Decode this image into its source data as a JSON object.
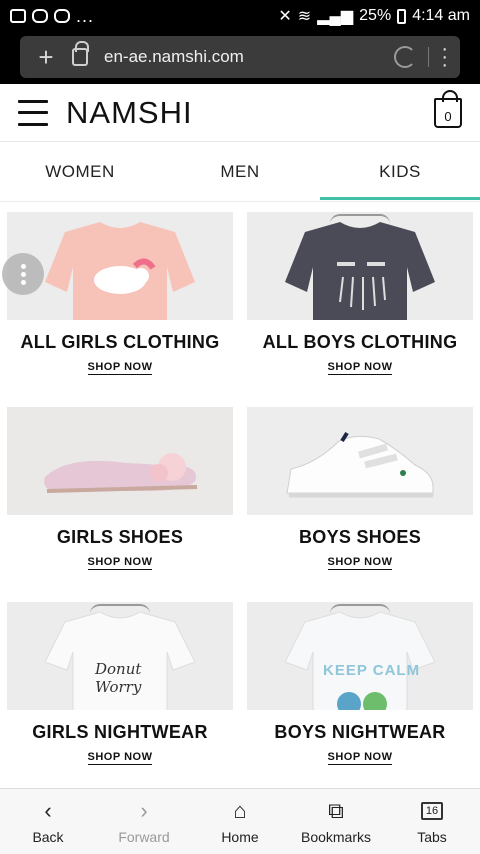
{
  "status_bar": {
    "battery": "25%",
    "time": "4:14 am",
    "more": "..."
  },
  "browser": {
    "url": "en-ae.namshi.com"
  },
  "site": {
    "logo": "NAMSHI",
    "cart_count": "0"
  },
  "tabs": [
    {
      "label": "WOMEN",
      "active": false
    },
    {
      "label": "MEN",
      "active": false
    },
    {
      "label": "KIDS",
      "active": true
    }
  ],
  "categories": [
    {
      "title": "ALL GIRLS CLOTHING",
      "cta": "SHOP NOW"
    },
    {
      "title": "ALL BOYS CLOTHING",
      "cta": "SHOP NOW"
    },
    {
      "title": "GIRLS SHOES",
      "cta": "SHOP NOW"
    },
    {
      "title": "BOYS SHOES",
      "cta": "SHOP NOW"
    },
    {
      "title": "GIRLS NIGHTWEAR",
      "cta": "SHOP NOW"
    },
    {
      "title": "BOYS NIGHTWEAR",
      "cta": "SHOP NOW"
    }
  ],
  "product_text": {
    "girls_tee_line1": "Donut",
    "girls_tee_line2": "Worry",
    "boys_tee": "KEEP CALM"
  },
  "bottom_nav": [
    {
      "label": "Back",
      "icon": "chevron-left-icon"
    },
    {
      "label": "Forward",
      "icon": "chevron-right-icon",
      "disabled": true
    },
    {
      "label": "Home",
      "icon": "home-icon"
    },
    {
      "label": "Bookmarks",
      "icon": "bookmarks-icon"
    },
    {
      "label": "Tabs",
      "icon": "tabs-icon",
      "count": "16"
    }
  ],
  "colors": {
    "accent": "#3ec1a6",
    "status_bar": "#000000",
    "url_bar": "#3b3b3b"
  }
}
